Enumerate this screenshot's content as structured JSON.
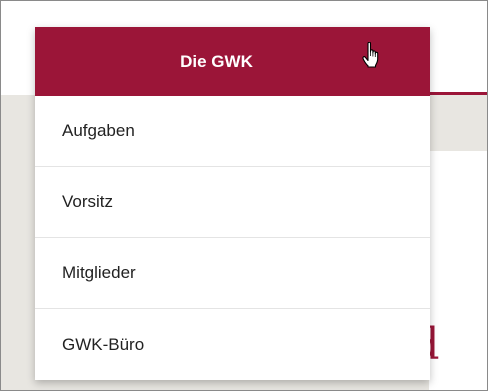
{
  "nav": {
    "menu_title": "Die GWK",
    "items": [
      {
        "label": "Aufgaben"
      },
      {
        "label": "Vorsitz"
      },
      {
        "label": "Mitglieder"
      },
      {
        "label": "GWK-Büro"
      }
    ]
  },
  "content": {
    "partial_heading": "nd"
  },
  "colors": {
    "accent": "#9b1538",
    "background": "#e8e6e1"
  },
  "icons": {
    "cursor": "hand-pointer-icon"
  }
}
